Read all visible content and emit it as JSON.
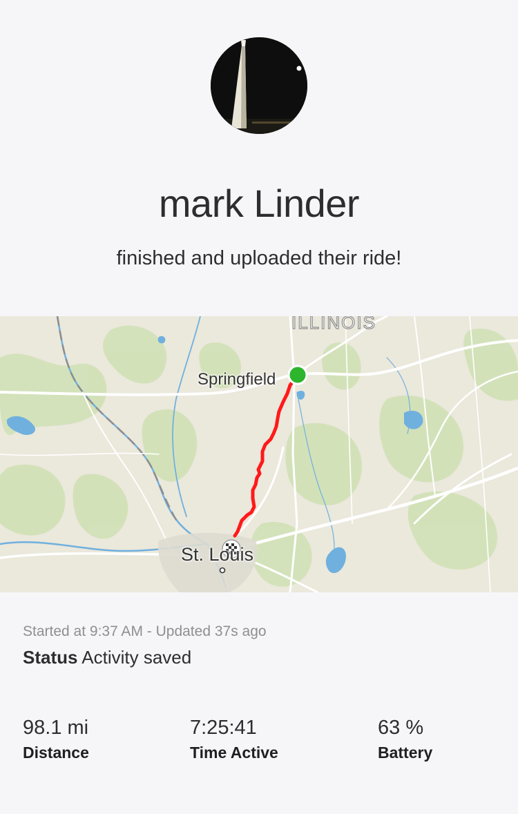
{
  "profile": {
    "name": "mark Linder",
    "subtitle": "finished and uploaded their ride!"
  },
  "map": {
    "state_label": "ILLINOIS",
    "city_labels": [
      "Springfield",
      "St. Louis"
    ],
    "route_color": "#ff1a1a",
    "start_marker_color": "#2db52d"
  },
  "activity": {
    "meta": "Started at 9:37 AM - Updated 37s ago",
    "status_key": "Status",
    "status_value": "Activity saved"
  },
  "stats": [
    {
      "value": "98.1 mi",
      "label": "Distance"
    },
    {
      "value": "7:25:41",
      "label": "Time Active"
    },
    {
      "value": "63 %",
      "label": "Battery"
    }
  ]
}
